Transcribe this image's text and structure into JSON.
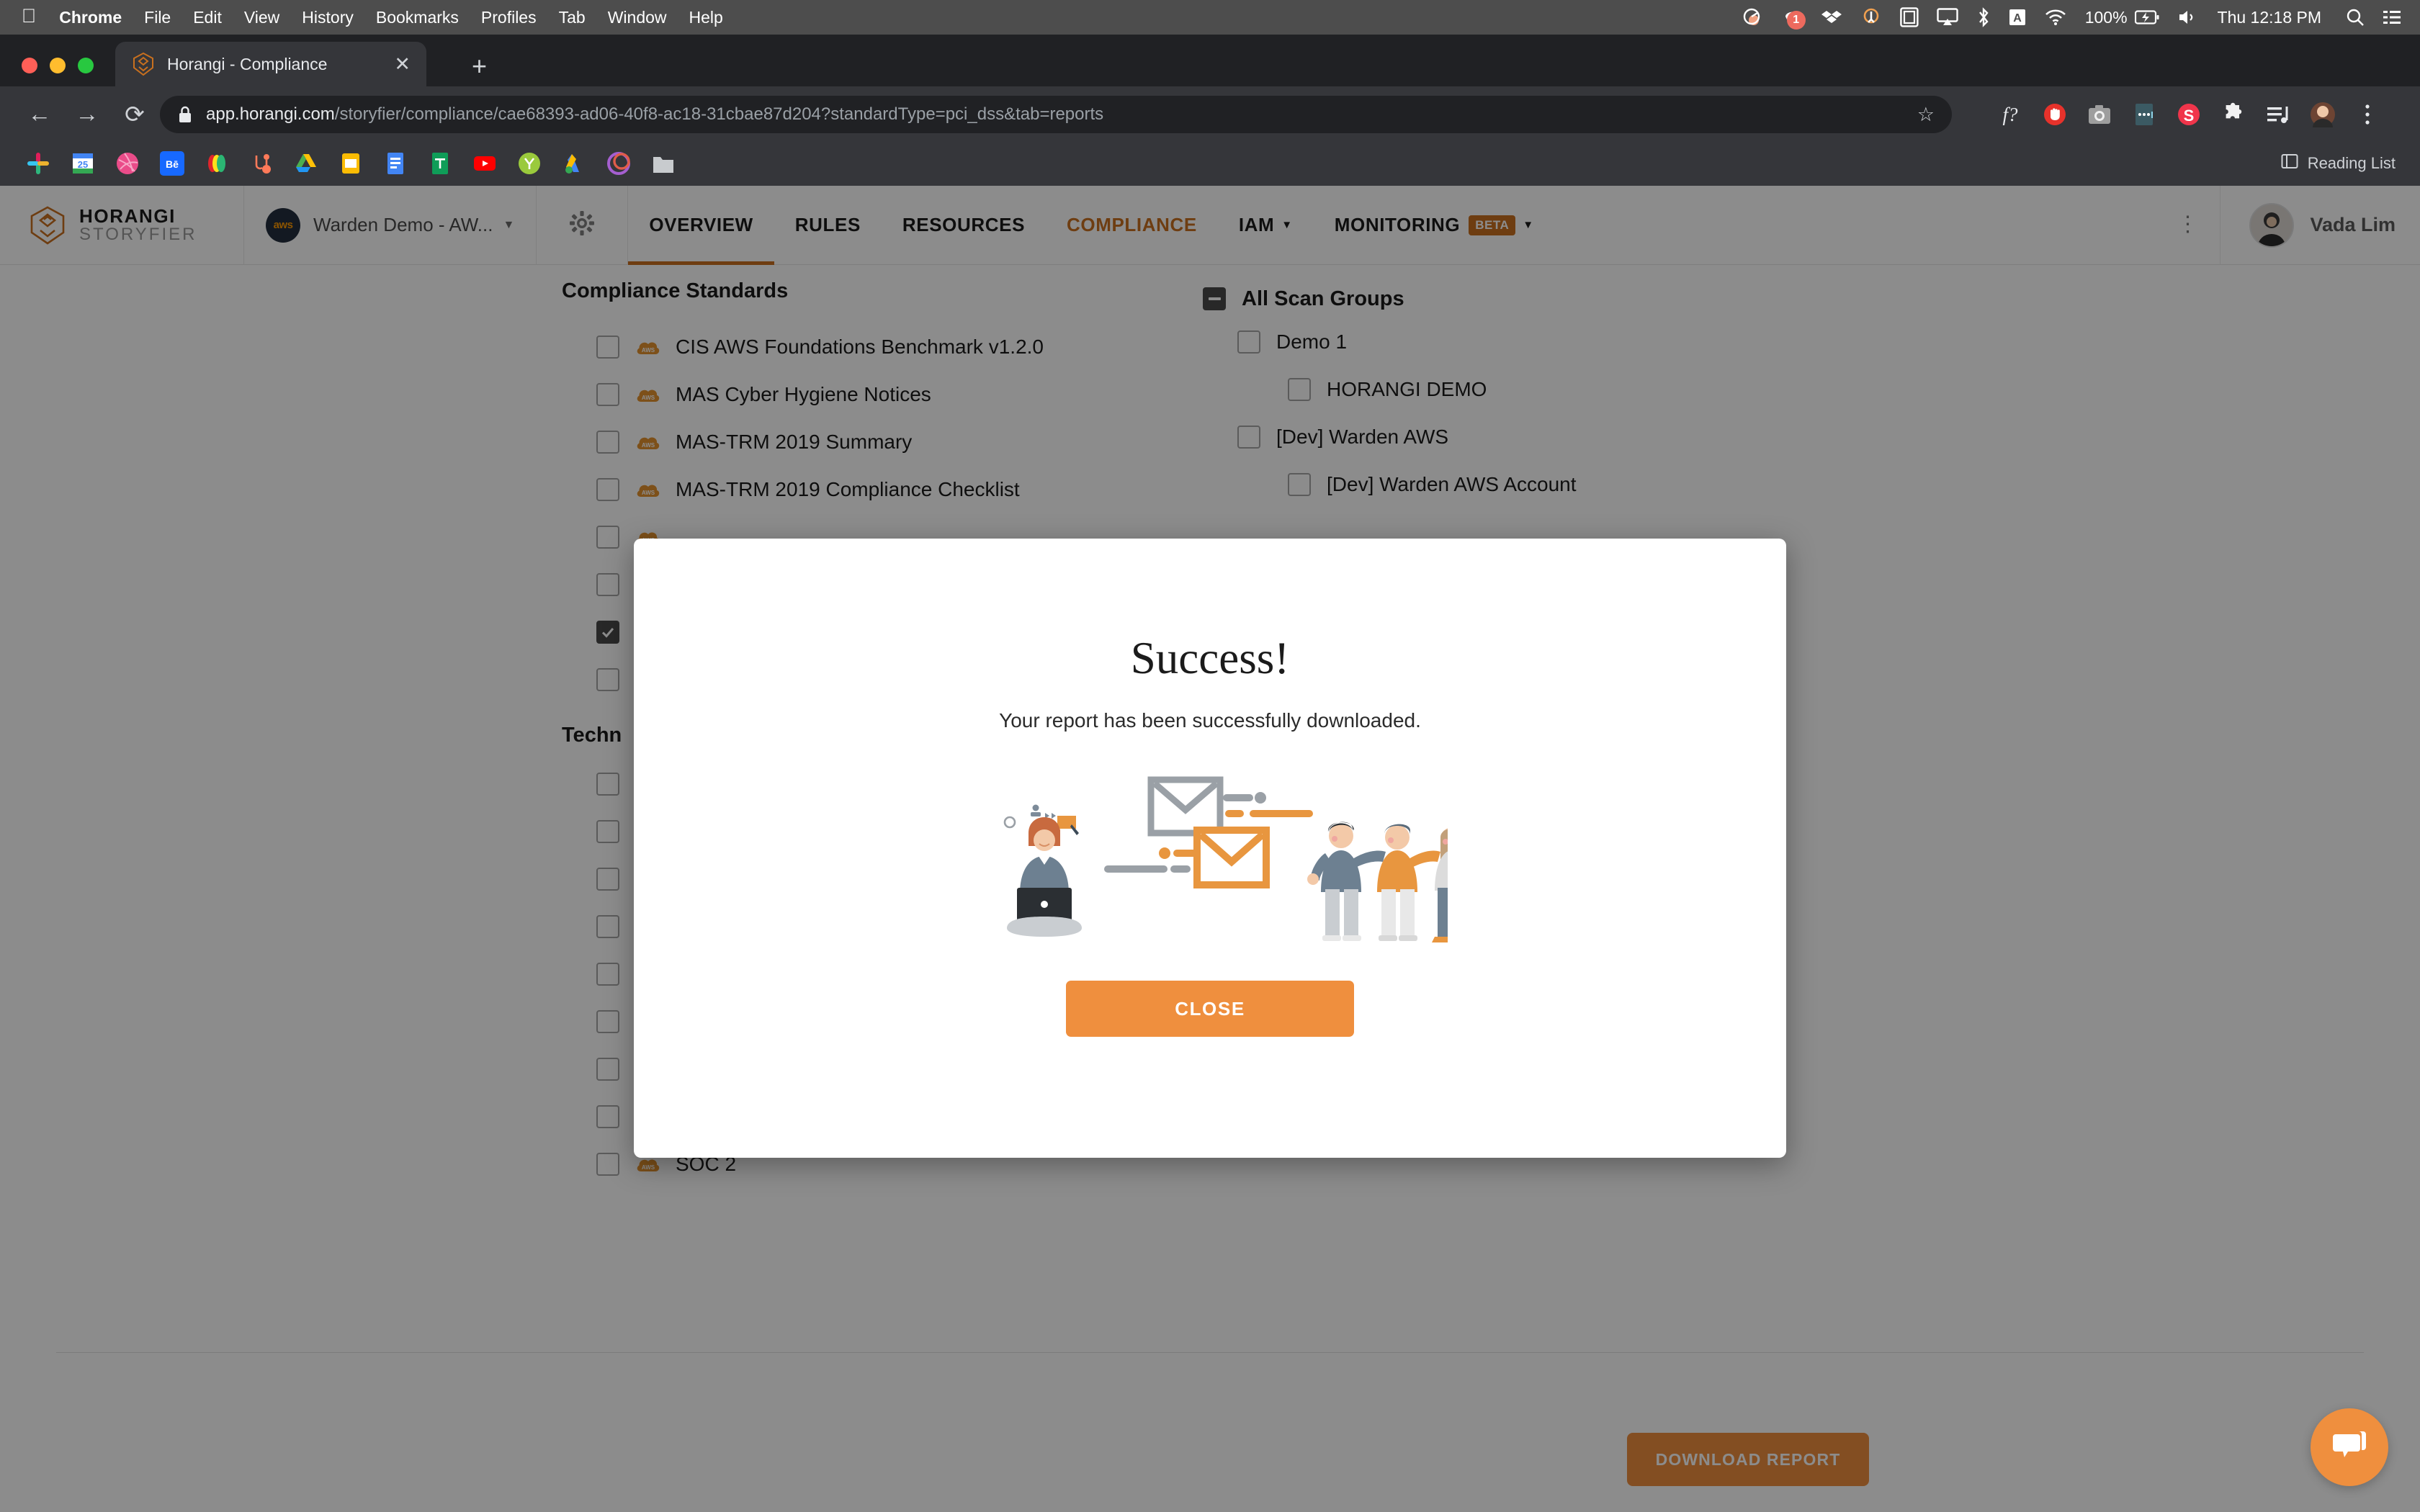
{
  "os_menubar": {
    "apple_icon": "apple-icon",
    "items": [
      {
        "label": "Chrome",
        "bold": true
      },
      {
        "label": "File",
        "bold": false
      },
      {
        "label": "Edit",
        "bold": false
      },
      {
        "label": "View",
        "bold": false
      },
      {
        "label": "History",
        "bold": false
      },
      {
        "label": "Bookmarks",
        "bold": false
      },
      {
        "label": "Profiles",
        "bold": false
      },
      {
        "label": "Tab",
        "bold": false
      },
      {
        "label": "Window",
        "bold": false
      },
      {
        "label": "Help",
        "bold": false
      }
    ],
    "status_icons": [
      "grammarly-icon",
      "notification-badge-icon",
      "dropbox-icon",
      "hubstaff-icon",
      "display-mirror-icon",
      "airplay-icon",
      "bluetooth-icon",
      "keyboard-input-icon",
      "wifi-icon"
    ],
    "notification_count": "1",
    "battery_percent": "100%",
    "battery_icon": "battery-charging-icon",
    "volume_icon": "volume-icon",
    "clock": "Thu 12:18 PM",
    "search_icon": "spotlight-search-icon",
    "control_center_icon": "control-center-icon"
  },
  "browser": {
    "tab": {
      "favicon": "horangi-lion-favicon",
      "title": "Horangi - Compliance",
      "close_icon": "close-icon"
    },
    "new_tab_label": "+",
    "back_icon": "back-arrow-icon",
    "forward_icon": "forward-arrow-icon",
    "reload_icon": "reload-icon",
    "omnibox": {
      "lock_icon": "lock-icon",
      "url_host": "app.horangi.com",
      "url_path": "/storyfier/compliance/cae68393-ad06-40f8-ac18-31cbae87d204?standardType=pci_dss&tab=reports",
      "bookmark_star_icon": "star-icon"
    },
    "extensions": [
      "font-inspector-icon",
      "adblock-icon",
      "screenshot-icon",
      "notes-icon",
      "sourcegraph-icon",
      "puzzle-extensions-icon",
      "playlist-icon",
      "profile-avatar-icon",
      "chrome-menu-kebab-icon"
    ],
    "bookmarks": [
      "slack-bookmark",
      "google-calendar-bookmark",
      "dribbble-bookmark",
      "behance-bookmark",
      "mailchimp-bookmark",
      "hubspot-bookmark",
      "google-drive-bookmark",
      "google-keep-bookmark",
      "google-docs-bookmark",
      "google-sheets-bookmark",
      "youtube-bookmark",
      "yubico-bookmark",
      "google-ads-bookmark",
      "loom-bookmark",
      "folder-bookmark"
    ],
    "reading_list_label": "Reading List",
    "reading_list_icon": "reading-list-icon"
  },
  "app": {
    "brand": {
      "line1": "HORANGI",
      "line2": "STORYFIER",
      "logo_icon": "horangi-lion-logo"
    },
    "account": {
      "provider_icon": "aws-icon",
      "provider_label": "aws",
      "name": "Warden Demo - AW...",
      "caret_icon": "chevron-down-icon"
    },
    "settings_icon": "gear-icon",
    "nav": [
      {
        "label": "OVERVIEW",
        "active": false,
        "underline": true,
        "caret": false,
        "badge": ""
      },
      {
        "label": "RULES",
        "active": false,
        "underline": false,
        "caret": false,
        "badge": ""
      },
      {
        "label": "RESOURCES",
        "active": false,
        "underline": false,
        "caret": false,
        "badge": ""
      },
      {
        "label": "COMPLIANCE",
        "active": true,
        "underline": false,
        "caret": false,
        "badge": ""
      },
      {
        "label": "IAM",
        "active": false,
        "underline": false,
        "caret": true,
        "badge": ""
      },
      {
        "label": "MONITORING",
        "active": false,
        "underline": false,
        "caret": true,
        "badge": "BETA"
      }
    ],
    "kebab_icon": "more-options-icon",
    "user": {
      "name": "Vada Lim",
      "avatar_icon": "user-avatar"
    }
  },
  "main": {
    "standards_title": "Compliance Standards",
    "standards": [
      {
        "label": "CIS AWS Foundations Benchmark v1.2.0",
        "checked": false,
        "cloud": "aws"
      },
      {
        "label": "MAS Cyber Hygiene Notices",
        "checked": false,
        "cloud": "aws"
      },
      {
        "label": "MAS-TRM 2019 Summary",
        "checked": false,
        "cloud": "aws"
      },
      {
        "label": "MAS-TRM 2019 Compliance Checklist",
        "checked": false,
        "cloud": "aws"
      },
      {
        "label": "",
        "checked": false,
        "cloud": "aws"
      },
      {
        "label": "",
        "checked": false,
        "cloud": "aws"
      },
      {
        "label": "",
        "checked": true,
        "cloud": "aws"
      },
      {
        "label": "",
        "checked": false,
        "cloud": "aws"
      }
    ],
    "section2_title": "Techn",
    "standards2": [
      {
        "label": "",
        "checked": false,
        "cloud": "aws"
      },
      {
        "label": "",
        "checked": false,
        "cloud": "aws"
      },
      {
        "label": "",
        "checked": false,
        "cloud": "aws"
      },
      {
        "label": "",
        "checked": false,
        "cloud": "aws"
      },
      {
        "label": "",
        "checked": false,
        "cloud": "aws"
      },
      {
        "label": "",
        "checked": false,
        "cloud": "aws"
      },
      {
        "label": "",
        "checked": false,
        "cloud": "aws"
      },
      {
        "label": "",
        "checked": false,
        "cloud": "aws"
      },
      {
        "label": "SOC 2",
        "checked": false,
        "cloud": "aws"
      }
    ],
    "scan_groups_title": "All Scan Groups",
    "scan_groups_state": "indeterminate",
    "scan_groups": [
      {
        "label": "Demo 1",
        "indent": 1,
        "checked": false
      },
      {
        "label": "HORANGI DEMO",
        "indent": 2,
        "checked": false
      },
      {
        "label": "[Dev] Warden AWS",
        "indent": 1,
        "checked": false
      },
      {
        "label": "[Dev] Warden AWS Account",
        "indent": 2,
        "checked": false
      }
    ],
    "download_button": "DOWNLOAD REPORT",
    "chat_icon": "chat-bubble-icon"
  },
  "modal": {
    "title": "Success!",
    "message": "Your report has been successfully downloaded.",
    "close_button": "CLOSE",
    "illustration": "email-sent-teamwork-illustration"
  },
  "colors": {
    "accent_orange": "#ef8f3e",
    "nav_active": "#c8701f",
    "chrome_dark": "#35363a",
    "omnibox_dark": "#202124",
    "menubar_gray": "#4d4d4d"
  }
}
